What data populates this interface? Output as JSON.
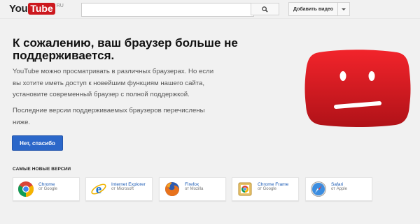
{
  "header": {
    "logo_you": "You",
    "logo_tube": "Tube",
    "logo_region": "RU",
    "search_placeholder": "",
    "upload_label": "Добавить видео"
  },
  "main": {
    "title": "К сожалению, ваш браузер больше не поддерживается.",
    "paragraph1": "YouTube можно просматривать в различных браузерах. Но если вы хотите иметь доступ к новейшим функциям нашего сайта, установите современный браузер с полной поддержкой.",
    "paragraph2": "Последние версии поддерживаемых браузеров перечислены ниже.",
    "dismiss_button": "Нет, спасибо",
    "section_title": "САМЫЕ НОВЫЕ ВЕРСИИ"
  },
  "browsers": [
    {
      "name": "Chrome",
      "vendor": "от Google",
      "icon": "chrome-icon"
    },
    {
      "name": "Internet Explorer",
      "vendor": "от Microsoft",
      "icon": "internet-explorer-icon"
    },
    {
      "name": "Firefox",
      "vendor": "от Mozilla",
      "icon": "firefox-icon"
    },
    {
      "name": "Chrome Frame",
      "vendor": "от Google",
      "icon": "chrome-frame-icon"
    },
    {
      "name": "Safari",
      "vendor": "от Apple",
      "icon": "safari-icon"
    }
  ],
  "colors": {
    "brand_red": "#cc181e",
    "button_blue": "#2b67c9",
    "link_blue": "#1a5ab4"
  }
}
